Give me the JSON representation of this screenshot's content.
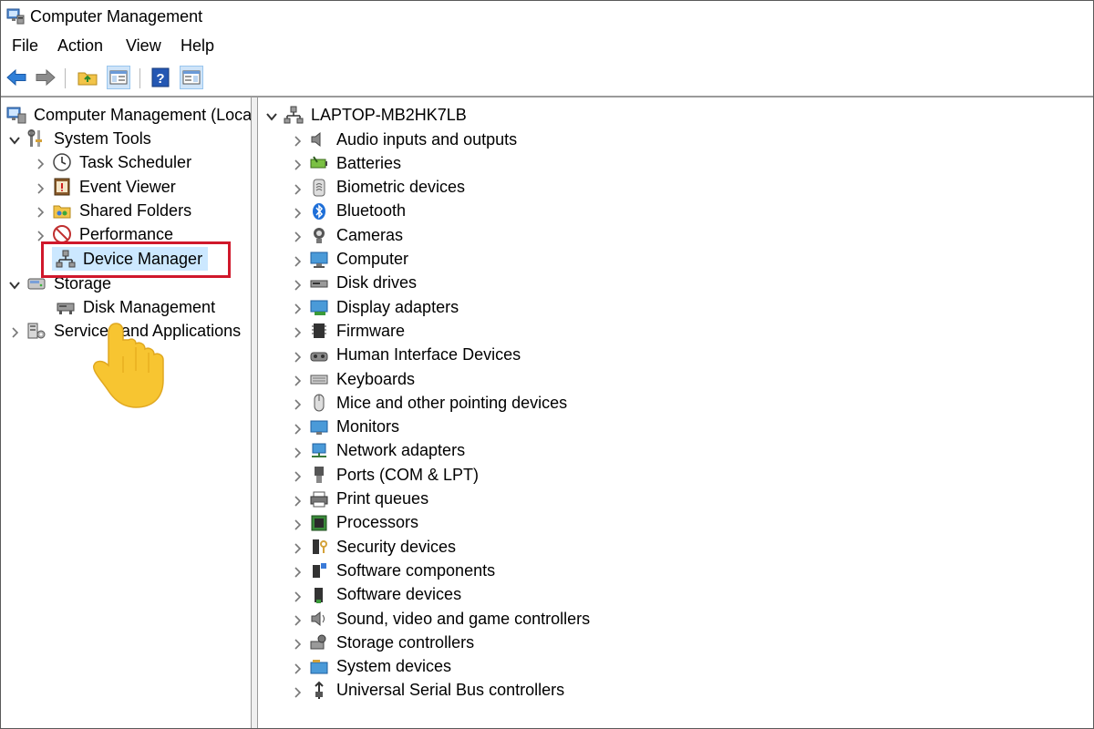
{
  "window": {
    "title": "Computer Management"
  },
  "menu": [
    "File",
    "Action",
    "View",
    "Help"
  ],
  "toolbar": [
    "back-arrow",
    "forward-arrow",
    "up-folder",
    "show-hide-console-tree",
    "help",
    "properties-pane"
  ],
  "left_tree": {
    "root": "Computer Management (Local",
    "system_tools": "System Tools",
    "task_scheduler": "Task Scheduler",
    "event_viewer": "Event Viewer",
    "shared_folders": "Shared Folders",
    "performance": "Performance",
    "device_manager": "Device Manager",
    "storage": "Storage",
    "disk_management": "Disk Management",
    "services_apps": "Services and Applications"
  },
  "right_tree": {
    "computer_name": "LAPTOP-MB2HK7LB",
    "categories": [
      "Audio inputs and outputs",
      "Batteries",
      "Biometric devices",
      "Bluetooth",
      "Cameras",
      "Computer",
      "Disk drives",
      "Display adapters",
      "Firmware",
      "Human Interface Devices",
      "Keyboards",
      "Mice and other pointing devices",
      "Monitors",
      "Network adapters",
      "Ports (COM & LPT)",
      "Print queues",
      "Processors",
      "Security devices",
      "Software components",
      "Software devices",
      "Sound, video and game controllers",
      "Storage controllers",
      "System devices",
      "Universal Serial Bus controllers"
    ]
  },
  "colors": {
    "highlight": "#d0182b",
    "selection": "#cce8ff",
    "hand": "#f7c531"
  }
}
